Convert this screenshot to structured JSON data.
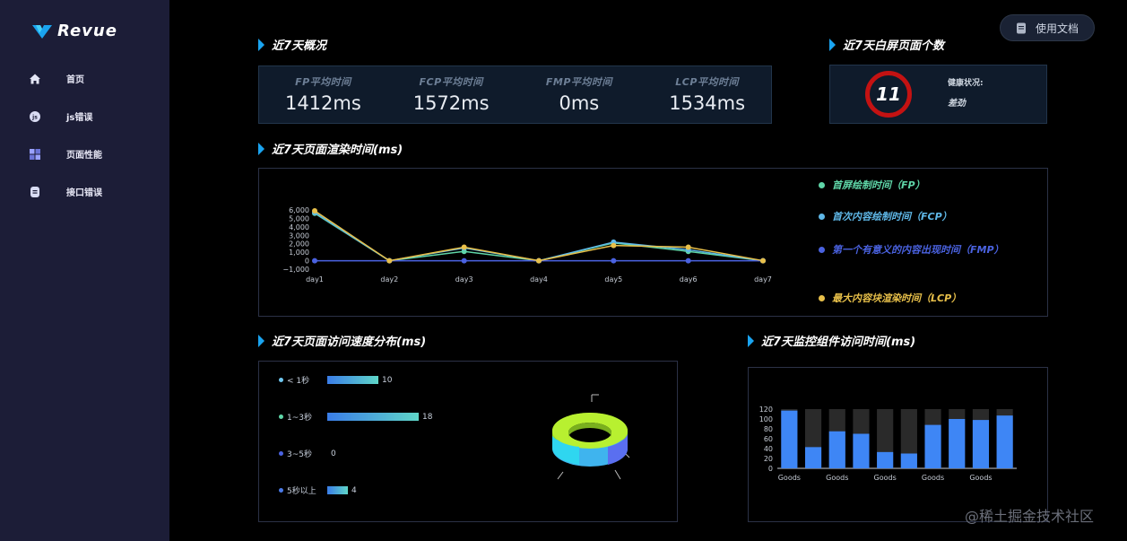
{
  "app": {
    "name": "Revue",
    "doc_button": "使用文档"
  },
  "sidebar": {
    "items": [
      {
        "label": "首页",
        "icon": "home-icon"
      },
      {
        "label": "js错误",
        "icon": "js-error-icon"
      },
      {
        "label": "页面性能",
        "icon": "grid-icon"
      },
      {
        "label": "接口错误",
        "icon": "api-error-icon"
      }
    ]
  },
  "overview": {
    "title": "近7天概况",
    "metrics": [
      {
        "label": "FP平均时间",
        "value": "1412ms"
      },
      {
        "label": "FCP平均时间",
        "value": "1572ms"
      },
      {
        "label": "FMP平均时间",
        "value": "0ms"
      },
      {
        "label": "LCP平均时间",
        "value": "1534ms"
      }
    ]
  },
  "white_screen": {
    "title": "近7天白屏页面个数",
    "count": "11",
    "health_label": "健康状况:",
    "health_value": "差劲",
    "ring_color": "#c41212"
  },
  "render_time": {
    "title": "近7天页面渲染时间(ms)",
    "legend": [
      {
        "label": "首屏绘制时间（FP）",
        "color": "#5fd6a8"
      },
      {
        "label": "首次内容绘制时间（FCP）",
        "color": "#5fb8e8"
      },
      {
        "label": "第一个有意义的内容出现时间（FMP）",
        "color": "#4a62e0"
      },
      {
        "label": "最大内容块渲染时间（LCP）",
        "color": "#e8c04a"
      }
    ]
  },
  "speed_dist": {
    "title": "近7天页面访问速度分布(ms)",
    "items": [
      {
        "label": "< 1秒",
        "value": "10",
        "color": "#6fc7f0"
      },
      {
        "label": "1~3秒",
        "value": "18",
        "color": "#5fd6a8"
      },
      {
        "label": "3~5秒",
        "value": "0",
        "color": "#4a62e0"
      },
      {
        "label": "5秒以上",
        "value": "4",
        "color": "#4a7ae8"
      }
    ]
  },
  "monitor": {
    "title": "近7天监控组件访问时间(ms)"
  },
  "watermark": "@稀土掘金技术社区",
  "chart_data": [
    {
      "type": "line",
      "x": [
        "day1",
        "day2",
        "day3",
        "day4",
        "day5",
        "day6",
        "day7"
      ],
      "yticks": [
        "6,000",
        "5,000",
        "4,000",
        "3,000",
        "2,000",
        "1,000",
        "0",
        "−1,000"
      ],
      "ylim": [
        -1000,
        6000
      ],
      "series": [
        {
          "name": "首屏绘制时间（FP）",
          "color": "#5fd6a8",
          "values": [
            5600,
            0,
            1100,
            0,
            2100,
            1100,
            0
          ]
        },
        {
          "name": "首次内容绘制时间（FCP）",
          "color": "#5fb8e8",
          "values": [
            5700,
            0,
            1500,
            0,
            2200,
            1300,
            0
          ]
        },
        {
          "name": "第一个有意义的内容出现时间（FMP）",
          "color": "#4a62e0",
          "values": [
            0,
            0,
            0,
            0,
            0,
            0,
            0
          ]
        },
        {
          "name": "最大内容块渲染时间（LCP）",
          "color": "#e8c04a",
          "values": [
            5900,
            0,
            1600,
            0,
            1800,
            1600,
            0
          ]
        }
      ]
    },
    {
      "type": "bar",
      "categories": [
        "Goods",
        "Goods",
        "Goods",
        "Goods",
        "Goods"
      ],
      "yticks": [
        "120",
        "100",
        "80",
        "60",
        "40",
        "20",
        "0"
      ],
      "ylim": [
        0,
        120
      ],
      "values": [
        117,
        43,
        75,
        70,
        33,
        30,
        88,
        100,
        98,
        107
      ],
      "background_max": 120,
      "bar_color": "#3e86f5",
      "background_color": "#2a2a2a"
    }
  ]
}
